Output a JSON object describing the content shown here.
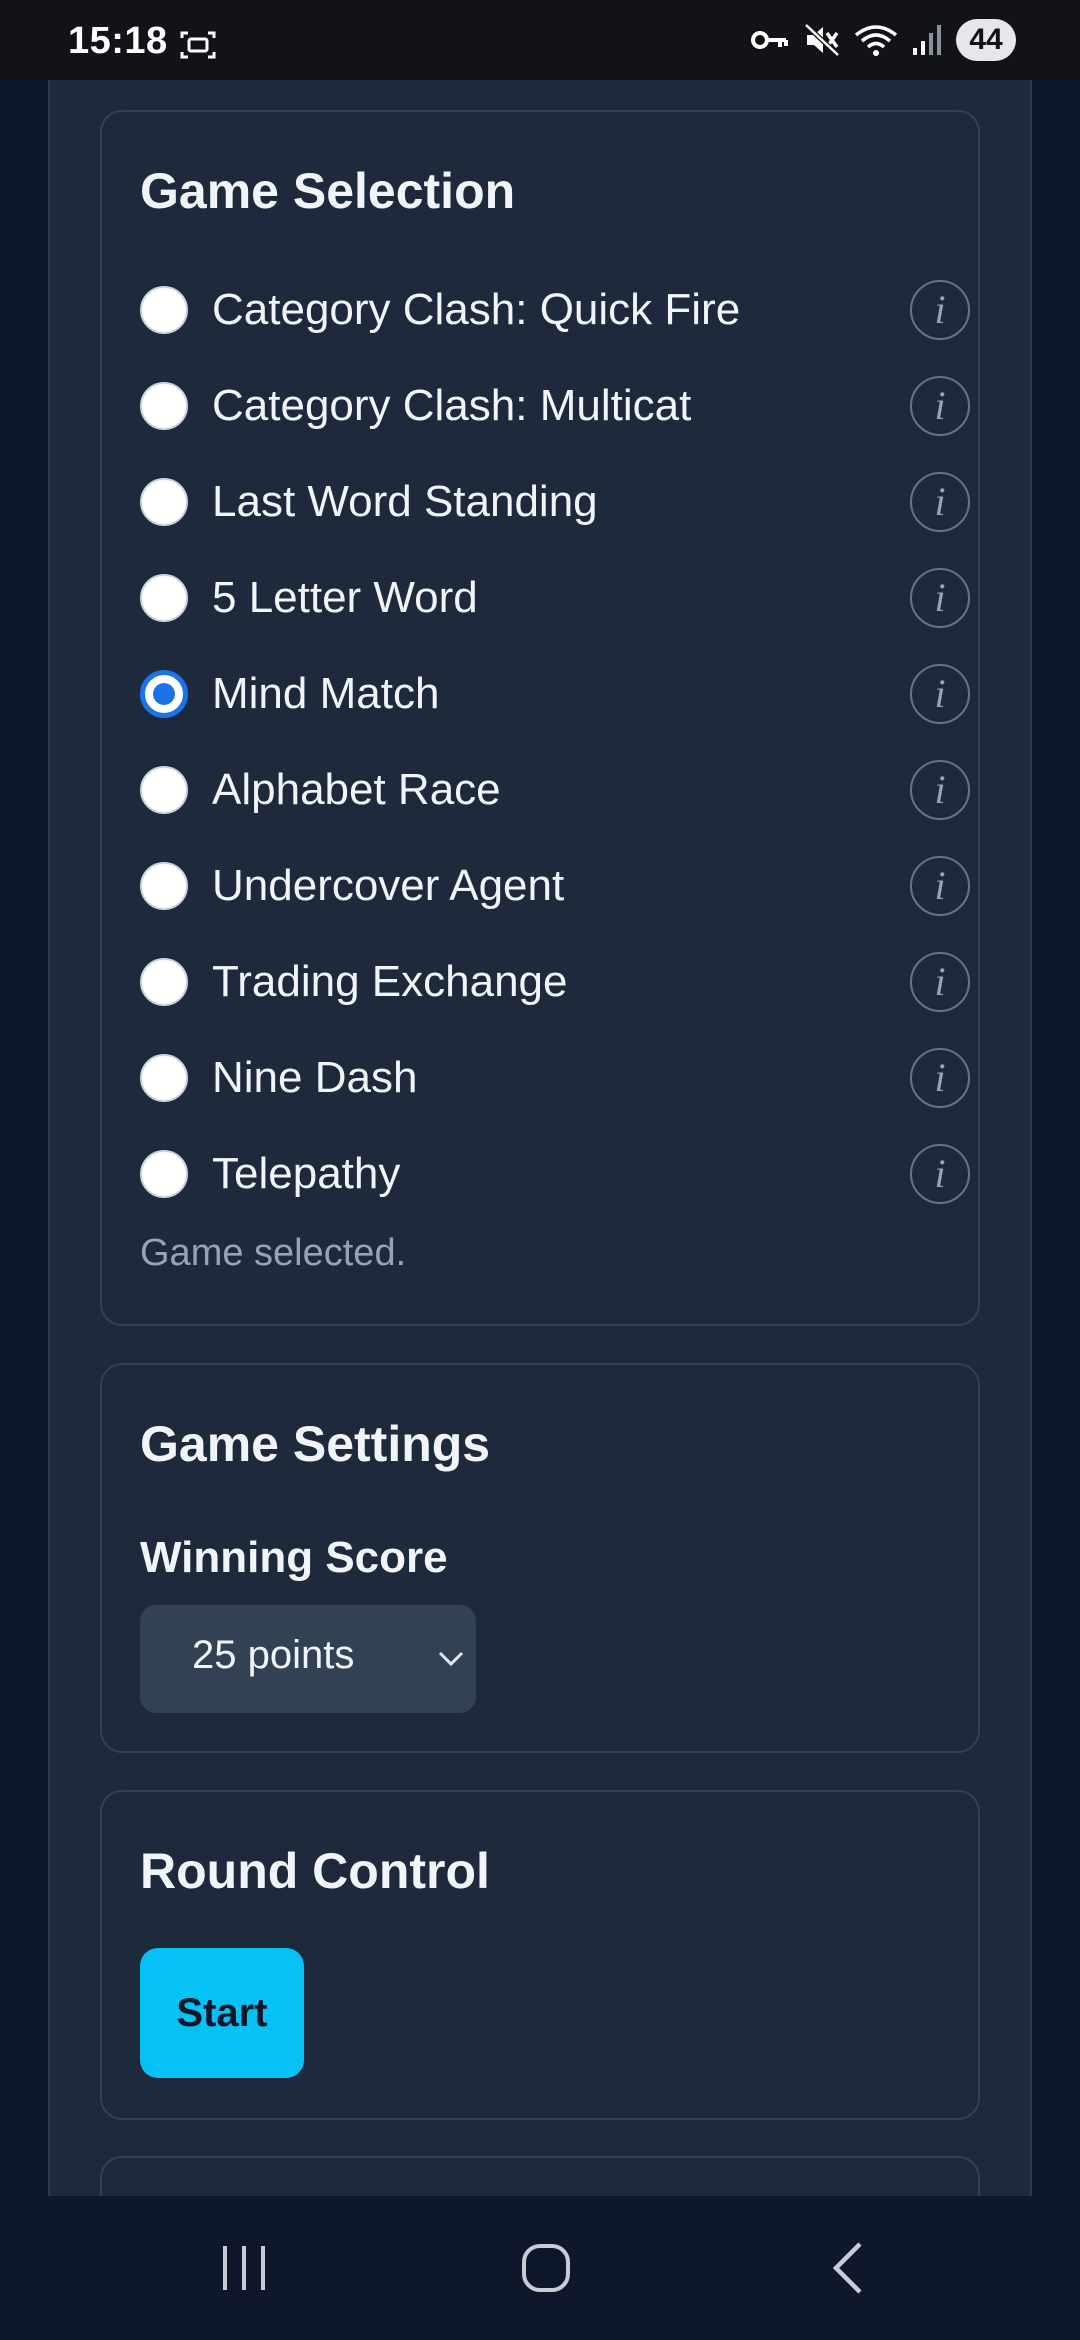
{
  "status_bar": {
    "time": "15:18",
    "battery": "44"
  },
  "game_selection": {
    "title": "Game Selection",
    "selected_index": 4,
    "games": [
      {
        "label": "Category Clash: Quick Fire"
      },
      {
        "label": "Category Clash: Multicat"
      },
      {
        "label": "Last Word Standing"
      },
      {
        "label": "5 Letter Word"
      },
      {
        "label": "Mind Match"
      },
      {
        "label": "Alphabet Race"
      },
      {
        "label": "Undercover Agent"
      },
      {
        "label": "Trading Exchange"
      },
      {
        "label": "Nine Dash"
      },
      {
        "label": "Telepathy"
      }
    ],
    "info_glyph": "i",
    "status_text": "Game selected."
  },
  "game_settings": {
    "title": "Game Settings",
    "winning_score_label": "Winning Score",
    "winning_score_value": "25 points"
  },
  "round_control": {
    "title": "Round Control",
    "start_label": "Start"
  },
  "colors": {
    "page_background": "#0f172a",
    "panel_background": "#1e293b",
    "card_border": "#334155",
    "radio_selected": "#1a73e8",
    "start_button": "#06c2f4",
    "muted_text": "#94a3b8"
  },
  "icons": {
    "status_left": "screen-capture-icon",
    "status_right": [
      "vpn-key-icon",
      "mute-icon",
      "wifi-icon",
      "signal-icon"
    ],
    "info": "info-icon",
    "select": "chevron-down-icon",
    "nav": [
      "recent-apps-icon",
      "home-icon",
      "back-icon"
    ]
  }
}
